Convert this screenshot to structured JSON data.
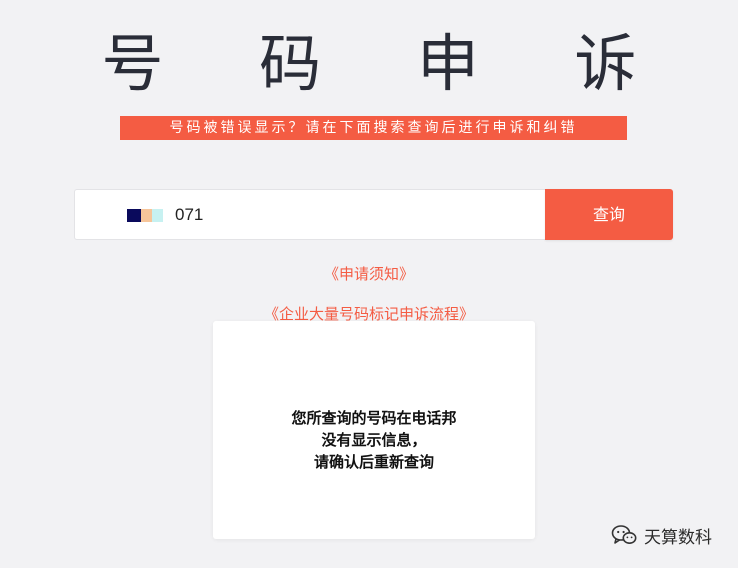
{
  "page": {
    "title": "号 码 申 诉",
    "subtitle": "号码被错误显示？请在下面搜索查询后进行申诉和纠错"
  },
  "search": {
    "value": "071",
    "masked_colors": [
      "#0a0a5c",
      "#f6c59a",
      "#c7f1f1"
    ],
    "button_label": "查询"
  },
  "links": {
    "notice": "《申请须知》",
    "process": "《企业大量号码标记申诉流程》"
  },
  "result": {
    "lines": [
      "您所查询的号码在电话邦",
      "没有显示信息，",
      "请确认后重新查询"
    ]
  },
  "watermark": {
    "text": "天算数科",
    "icon": "wechat-icon"
  },
  "colors": {
    "accent": "#f45c43",
    "background": "#f2f2f4"
  }
}
